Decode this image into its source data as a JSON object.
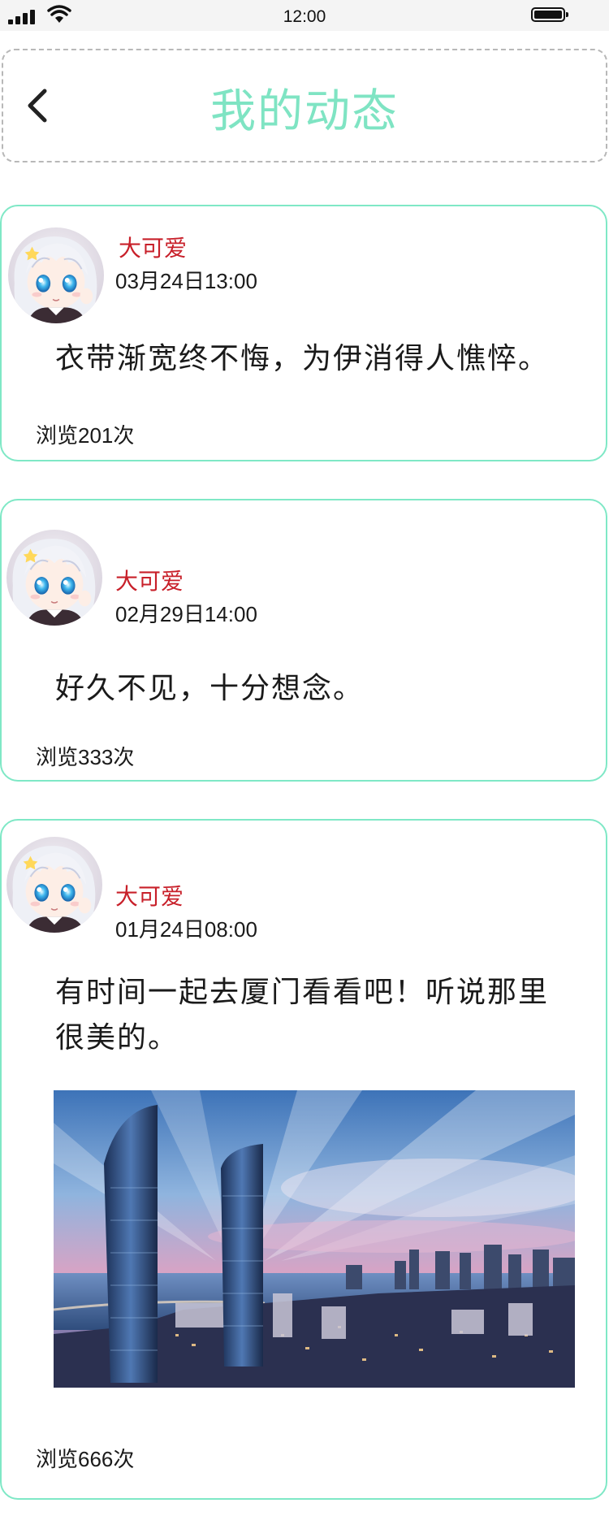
{
  "status_bar": {
    "time": "12:00"
  },
  "header": {
    "title": "我的动态",
    "back_icon": "chevron-left-icon"
  },
  "colors": {
    "accent": "#7fe4c3",
    "card_border": "#7fe8c6",
    "username": "#c8202a"
  },
  "posts": [
    {
      "username": "大可爱",
      "time": "03月24日13:00",
      "content": "衣带渐宽终不悔，为伊消得人憔悴。",
      "views": "浏览201次"
    },
    {
      "username": "大可爱",
      "time": "02月29日14:00",
      "content": "好久不见，十分想念。",
      "views": "浏览333次"
    },
    {
      "username": "大可爱",
      "time": "01月24日08:00",
      "content_line1": "有时间一起去厦门看看吧！听说那里",
      "content_line2": "很美的。",
      "views": "浏览666次",
      "photo_icon": "city-skyline-photo"
    }
  ]
}
